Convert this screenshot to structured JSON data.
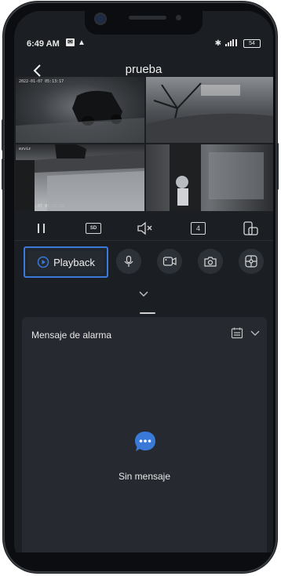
{
  "status_bar": {
    "time": "6:49 AM",
    "left_icons": [
      "message-icon",
      "warning-icon"
    ],
    "right_icons": [
      "bluetooth-icon",
      "signal-icon",
      "battery-icon"
    ],
    "battery_level": "54"
  },
  "header": {
    "title": "prueba",
    "back_icon": "chevron-left-icon"
  },
  "cameras": [
    {
      "id": "cam-1",
      "timestamp": "2022-01-07 05:13:17"
    },
    {
      "id": "cam-2",
      "timestamp": ""
    },
    {
      "id": "cam-3",
      "timestamp": "2022-01-07 05:13:18",
      "brand": "ezviz"
    },
    {
      "id": "cam-4",
      "timestamp": ""
    }
  ],
  "controls": {
    "pause_icon": "pause-icon",
    "quality_label": "SD",
    "mute_icon": "speaker-muted-icon",
    "split_label": "4",
    "rotate_icon": "phone-rotate-icon"
  },
  "actions": {
    "playback_label": "Playback",
    "icons": [
      "microphone-icon",
      "record-video-icon",
      "camera-icon",
      "ptz-icon"
    ]
  },
  "alarm_panel": {
    "title": "Mensaje de alarma",
    "empty_text": "Sin mensaje"
  },
  "colors": {
    "background": "#1b1e22",
    "panel": "#262a30",
    "accent": "#3a79d8",
    "empty_icon": "#3a79d8"
  }
}
